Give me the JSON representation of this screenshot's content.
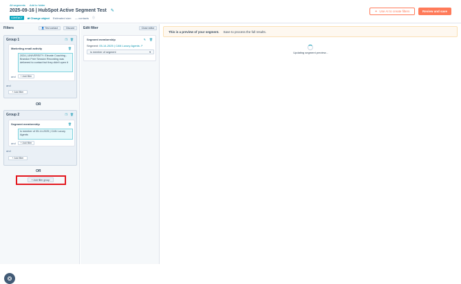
{
  "header": {
    "breadcrumbs": [
      "All segments",
      "Add to folder"
    ],
    "title": "2025-09-16 | HubSpot Active Segment Test",
    "badge": "CONTACT",
    "change_object": "Change object",
    "estimated_size_label": "Estimated size:",
    "estimated_size_value": "— contacts",
    "ai_button": "Use AI to create filters",
    "save_button": "Review and save"
  },
  "filters_panel": {
    "heading": "Filters",
    "test_contact": "Test contact",
    "discard": "Discard",
    "groups": [
      {
        "title": "Group 1",
        "filter_title": "Marketing email activity",
        "criteria": "2024 | UNIVERSITY: Elevate Coaching - Brandon Free Session Recording was delivered to contact but they didn't open it",
        "add_filter_inner": "+ Add filter",
        "and": "and",
        "add_filter": "+ Add filter"
      },
      {
        "title": "Group 2",
        "filter_title": "Segment membership",
        "criteria": "is member of 05-14-2025 | CAN Luxury Agents",
        "add_filter_inner": "+ Add filter",
        "and": "and",
        "add_filter": "+ Add filter"
      }
    ],
    "or_label": "OR",
    "add_filter_group": "+ Add filter group"
  },
  "edit_panel": {
    "heading": "Edit filter",
    "close_editor": "Close editor",
    "card_title": "Segment membership",
    "segment_prefix": "Segment:",
    "segment_name": "05-14-2025 | CAN Luxury Agents",
    "select_value": "is member of segment"
  },
  "preview": {
    "banner_title": "This is a preview of your segment.",
    "banner_text": "Save to process the full results.",
    "status": "Updating segment preview..."
  }
}
